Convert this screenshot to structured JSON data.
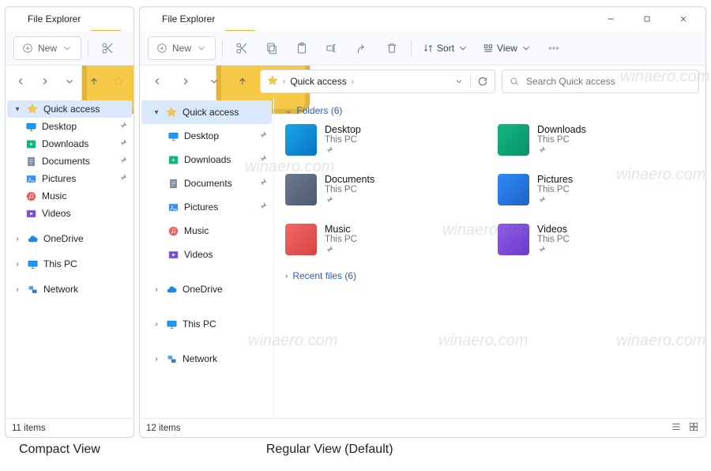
{
  "captions": {
    "compact": "Compact View",
    "regular": "Regular View (Default)"
  },
  "watermark": "winaero.com",
  "compact": {
    "title": "File Explorer",
    "new_label": "New",
    "status_items": "11 items",
    "tree": {
      "quick_access": "Quick access",
      "items": [
        {
          "label": "Desktop"
        },
        {
          "label": "Downloads"
        },
        {
          "label": "Documents"
        },
        {
          "label": "Pictures"
        },
        {
          "label": "Music"
        },
        {
          "label": "Videos"
        }
      ],
      "roots": [
        {
          "label": "OneDrive"
        },
        {
          "label": "This PC"
        },
        {
          "label": "Network"
        }
      ]
    }
  },
  "regular": {
    "title": "File Explorer",
    "new_label": "New",
    "sort_label": "Sort",
    "view_label": "View",
    "breadcrumb": "Quick access",
    "search_placeholder": "Search Quick access",
    "status_items": "12 items",
    "tree": {
      "quick_access": "Quick access",
      "items": [
        {
          "label": "Desktop"
        },
        {
          "label": "Downloads"
        },
        {
          "label": "Documents"
        },
        {
          "label": "Pictures"
        },
        {
          "label": "Music"
        },
        {
          "label": "Videos"
        }
      ],
      "roots": [
        {
          "label": "OneDrive"
        },
        {
          "label": "This PC"
        },
        {
          "label": "Network"
        }
      ]
    },
    "folders_header": "Folders  (6)",
    "recent_header": "Recent files  (6)",
    "folders": [
      {
        "name": "Desktop",
        "loc": "This PC",
        "icon": "ico-desktop"
      },
      {
        "name": "Downloads",
        "loc": "This PC",
        "icon": "ico-downloads"
      },
      {
        "name": "Documents",
        "loc": "This PC",
        "icon": "ico-documents"
      },
      {
        "name": "Pictures",
        "loc": "This PC",
        "icon": "ico-pictures"
      },
      {
        "name": "Music",
        "loc": "This PC",
        "icon": "ico-music"
      },
      {
        "name": "Videos",
        "loc": "This PC",
        "icon": "ico-videos"
      }
    ]
  }
}
